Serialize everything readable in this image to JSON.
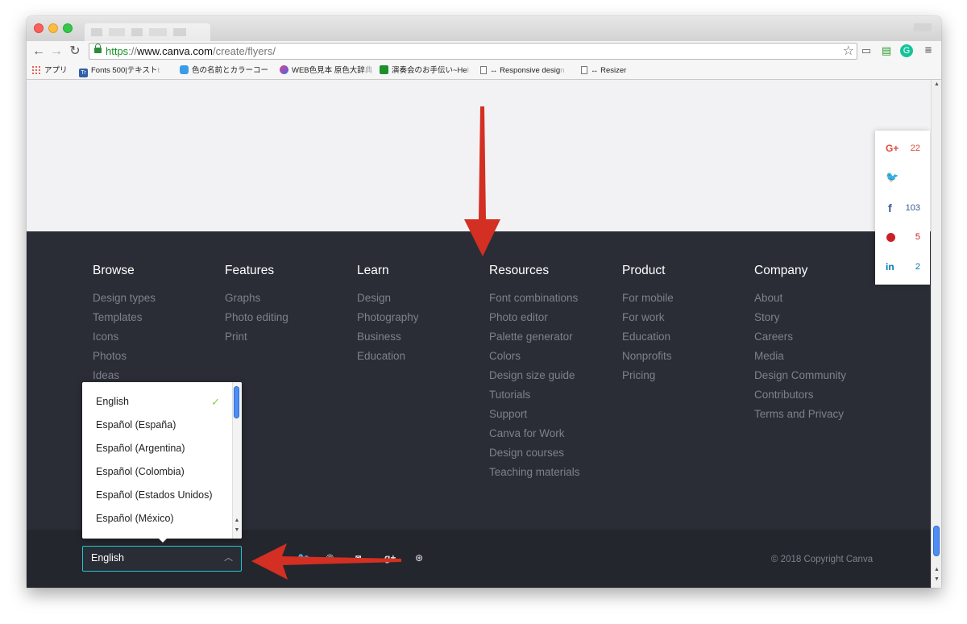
{
  "browser": {
    "url_scheme": "https",
    "url_sep": "://",
    "url_host": "www.canva.com",
    "url_path": "/create/flyers/"
  },
  "bookmarks": [
    {
      "label": "アプリ"
    },
    {
      "label": "Fonts 500|テキスト",
      "fade": "t"
    },
    {
      "label": "色の名前とカラーコー",
      "fade": ""
    },
    {
      "label": "WEB色見本 原色大辞",
      "fade": "典"
    },
    {
      "label": "演奏会のお手伝い~He",
      "fade": "l"
    },
    {
      "label": "↔ Responsive desig",
      "fade": "n"
    },
    {
      "label": "↔ Resizer",
      "fade": ""
    }
  ],
  "share": {
    "google_plus": {
      "icon": "G+",
      "count": "22"
    },
    "twitter": {
      "icon": "twitter-icon",
      "count": ""
    },
    "facebook": {
      "icon": "f",
      "count": "103"
    },
    "pinterest": {
      "icon": "pinterest-icon",
      "count": "5"
    },
    "linkedin": {
      "icon": "in",
      "count": "2"
    },
    "colors": {
      "google_plus": "#dd4b39",
      "twitter": "#55acee",
      "facebook": "#3b5998",
      "pinterest": "#cb2027",
      "linkedin": "#0077b5"
    }
  },
  "footer": {
    "columns": [
      {
        "title": "Browse",
        "links": [
          "Design types",
          "Templates",
          "Icons",
          "Photos",
          "Ideas"
        ]
      },
      {
        "title": "Features",
        "links": [
          "Graphs",
          "Photo editing",
          "Print"
        ]
      },
      {
        "title": "Learn",
        "links": [
          "Design",
          "Photography",
          "Business",
          "Education"
        ]
      },
      {
        "title": "Resources",
        "links": [
          "Font combinations",
          "Photo editor",
          "Palette generator",
          "Colors",
          "Design size guide",
          "Tutorials",
          "Support",
          "Canva for Work",
          "Design courses",
          "Teaching materials"
        ]
      },
      {
        "title": "Product",
        "links": [
          "For mobile",
          "For work",
          "Education",
          "Nonprofits",
          "Pricing"
        ]
      },
      {
        "title": "Company",
        "links": [
          "About",
          "Story",
          "Careers",
          "Media",
          "Design Community",
          "Contributors",
          "Terms and Privacy"
        ]
      }
    ],
    "copyright": "© 2018 Copyright Canva",
    "language_selected": "English",
    "language_options": [
      "English",
      "Español (España)",
      "Español (Argentina)",
      "Español (Colombia)",
      "Español (Estados Unidos)",
      "Español (México)"
    ],
    "social_icons": [
      "twitter-icon",
      "pinterest-icon",
      "instagram-icon",
      "google-plus-icon",
      "dribbble-icon"
    ]
  },
  "colors": {
    "footer_bg": "#2a2d35",
    "footer_bottom_bg": "#24262d",
    "select_border": "#21c5d4",
    "check": "#7fce3f",
    "annotation_arrow": "#d32f22"
  }
}
